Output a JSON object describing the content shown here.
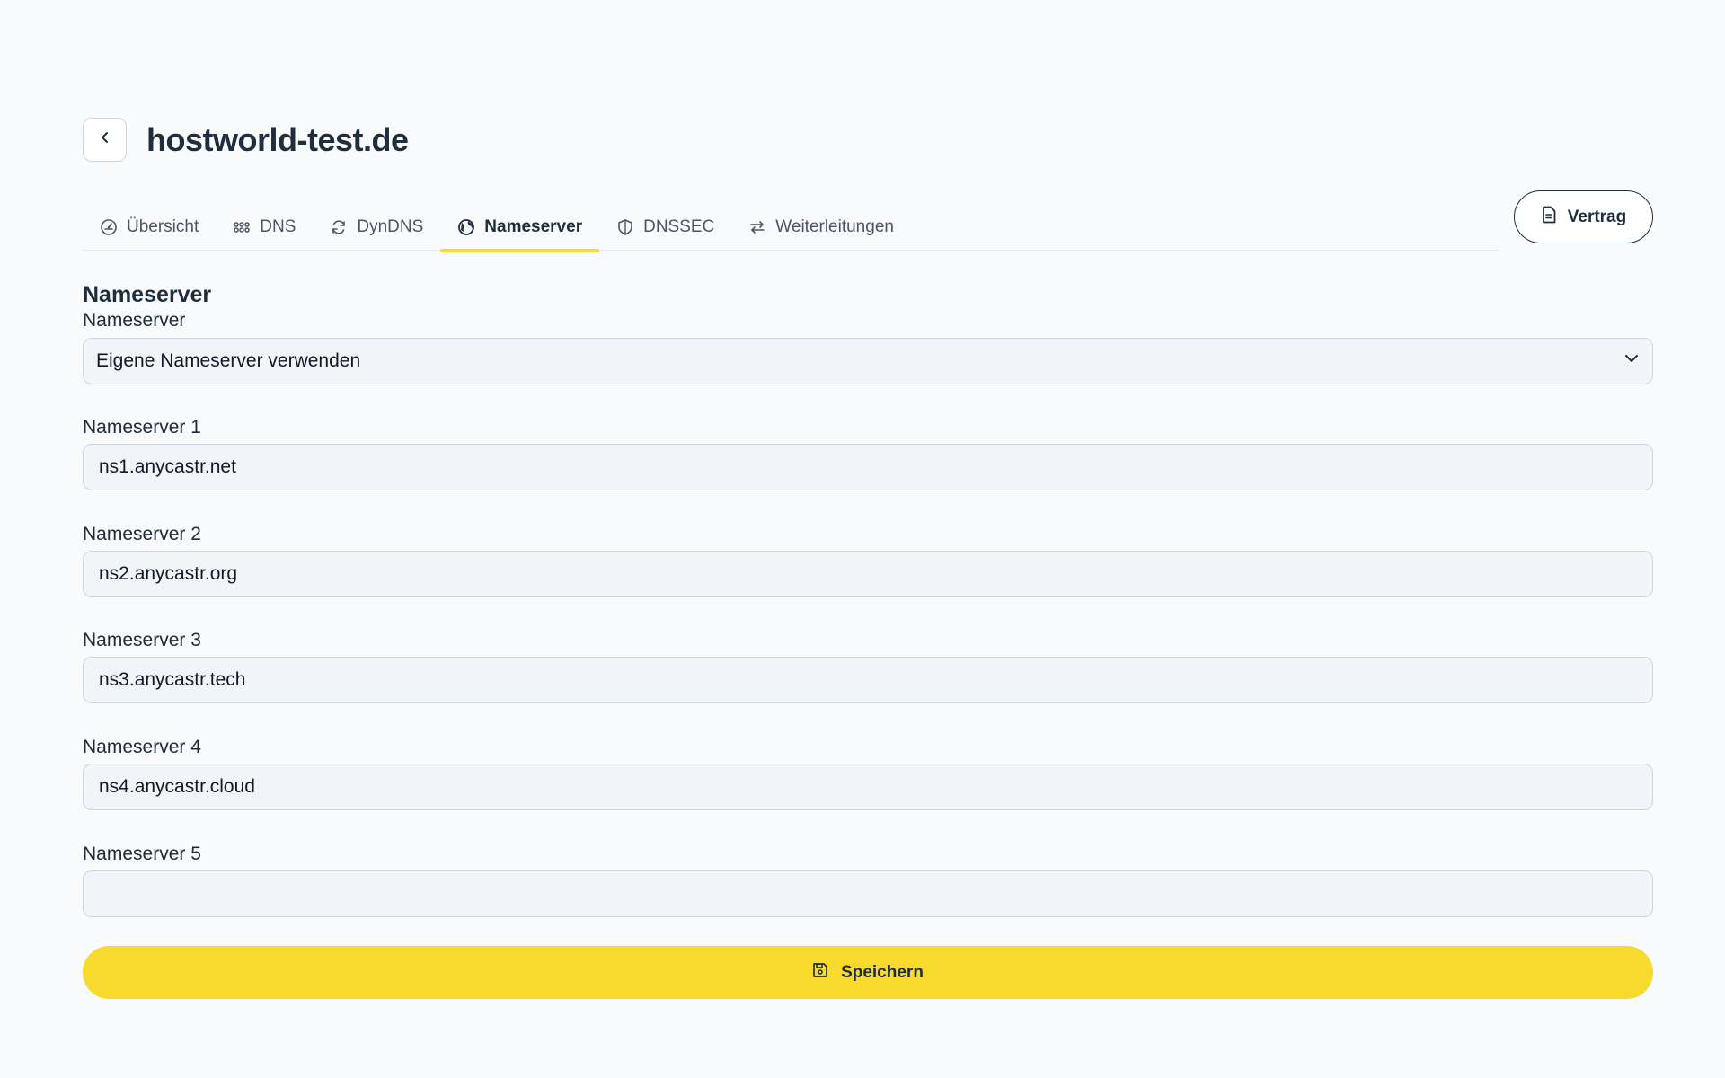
{
  "header": {
    "title": "hostworld-test.de"
  },
  "tabs": [
    {
      "label": "Übersicht",
      "icon": "dashboard-icon"
    },
    {
      "label": "DNS",
      "icon": "grid-dots-icon"
    },
    {
      "label": "DynDNS",
      "icon": "refresh-icon"
    },
    {
      "label": "Nameserver",
      "icon": "globe-icon",
      "active": true
    },
    {
      "label": "DNSSEC",
      "icon": "shield-icon"
    },
    {
      "label": "Weiterleitungen",
      "icon": "arrows-exchange-icon"
    }
  ],
  "contract_button": {
    "label": "Vertrag",
    "icon": "document-icon"
  },
  "form": {
    "section_title": "Nameserver",
    "mode": {
      "label": "Nameserver",
      "value": "Eigene Nameserver verwenden"
    },
    "ns1": {
      "label": "Nameserver 1",
      "value": "ns1.anycastr.net"
    },
    "ns2": {
      "label": "Nameserver 2",
      "value": "ns2.anycastr.org"
    },
    "ns3": {
      "label": "Nameserver 3",
      "value": "ns3.anycastr.tech"
    },
    "ns4": {
      "label": "Nameserver 4",
      "value": "ns4.anycastr.cloud"
    },
    "ns5": {
      "label": "Nameserver 5",
      "value": ""
    },
    "save_label": "Speichern"
  },
  "colors": {
    "accent": "#f8d92e",
    "text_dark": "#1f2d3d",
    "field_bg": "#f1f5f9",
    "page_bg": "#f8fafc"
  }
}
